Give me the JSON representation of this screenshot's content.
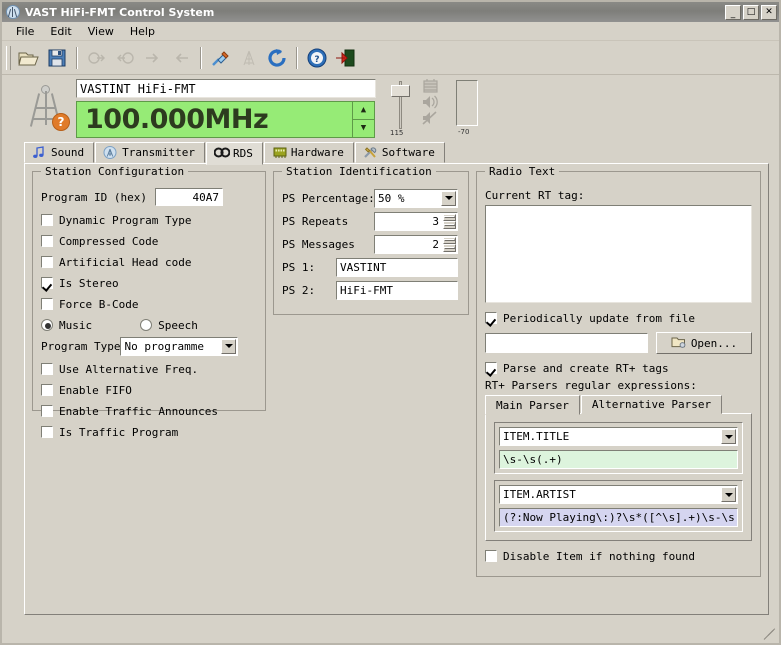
{
  "window": {
    "title": "VAST HiFi-FMT Control System",
    "icon": "antenna-icon",
    "minimize": "_",
    "maximize": "□",
    "close": "✕"
  },
  "menu": {
    "items": [
      "File",
      "Edit",
      "View",
      "Help"
    ]
  },
  "toolbar": {
    "buttons": [
      {
        "name": "open-file-icon",
        "enabled": true
      },
      {
        "name": "save-file-icon",
        "enabled": true
      },
      {
        "name": "upload-to-device-icon",
        "enabled": false
      },
      {
        "name": "download-from-device-icon",
        "enabled": false
      },
      {
        "name": "arrow-right-icon",
        "enabled": false
      },
      {
        "name": "arrow-left-icon",
        "enabled": false
      },
      {
        "name": "connect-icon",
        "enabled": true
      },
      {
        "name": "transmitter-icon",
        "enabled": false
      },
      {
        "name": "refresh-icon",
        "enabled": true
      },
      {
        "name": "help-icon",
        "enabled": true
      },
      {
        "name": "exit-icon",
        "enabled": true
      }
    ]
  },
  "header": {
    "station_name": "VASTINT HiFi-FMT",
    "frequency": "100.000MHz",
    "slider_value": "115",
    "meter_value": "-70",
    "status_badge": "?"
  },
  "tabs": [
    {
      "label": "Sound",
      "icon": "music-note-icon",
      "active": false
    },
    {
      "label": "Transmitter",
      "icon": "antenna-icon",
      "active": false
    },
    {
      "label": "RDS",
      "icon": "rds-icon",
      "active": true
    },
    {
      "label": "Hardware",
      "icon": "chip-icon",
      "active": false
    },
    {
      "label": "Software",
      "icon": "tools-icon",
      "active": false
    }
  ],
  "station_configuration": {
    "legend": "Station Configuration",
    "program_id_label": "Program ID (hex)",
    "program_id_value": "40A7",
    "checkboxes": [
      {
        "label": "Dynamic Program Type",
        "checked": false
      },
      {
        "label": "Compressed Code",
        "checked": false
      },
      {
        "label": "Artificial Head code",
        "checked": false
      },
      {
        "label": "Is Stereo",
        "checked": true
      },
      {
        "label": "Force B-Code",
        "checked": false
      }
    ],
    "radios": [
      {
        "label": "Music",
        "checked": true
      },
      {
        "label": "Speech",
        "checked": false
      }
    ],
    "program_type_label": "Program Type",
    "program_type_value": "No programme",
    "checkboxes2": [
      {
        "label": "Use Alternative Freq.",
        "checked": false
      },
      {
        "label": "Enable FIFO",
        "checked": false
      },
      {
        "label": "Enable Traffic Announces",
        "checked": false
      },
      {
        "label": "Is Traffic Program",
        "checked": false
      }
    ]
  },
  "station_identification": {
    "legend": "Station Identification",
    "fields": [
      {
        "label": "PS Percentage:",
        "value": "50 %",
        "type": "combo"
      },
      {
        "label": "PS Repeats",
        "value": "3",
        "type": "spinner"
      },
      {
        "label": "PS Messages",
        "value": "2",
        "type": "spinner"
      },
      {
        "label": "PS 1:",
        "value": "VASTINT",
        "type": "text"
      },
      {
        "label": "PS 2:",
        "value": "HiFi-FMT",
        "type": "text"
      }
    ]
  },
  "radio_text": {
    "legend": "Radio Text",
    "current_rt_label": "Current RT tag:",
    "current_rt_value": "",
    "periodic_update": {
      "label": "Periodically update from file",
      "checked": true
    },
    "file_path": "",
    "open_button": "Open...",
    "parse_rtplus": {
      "label": "Parse and create RT+ tags",
      "checked": true
    },
    "parsers_label": "RT+ Parsers regular expressions:",
    "parser_tabs": [
      {
        "label": "Main Parser",
        "active": true
      },
      {
        "label": "Alternative Parser",
        "active": false
      }
    ],
    "parsers": [
      {
        "item": "ITEM.TITLE",
        "regex": "\\s-\\s(.+)",
        "regex_bg": "#ddf4dd"
      },
      {
        "item": "ITEM.ARTIST",
        "regex": "(?:Now Playing\\:)?\\s*([^\\s].+)\\s-\\s",
        "regex_bg": "#d5d5f0"
      }
    ],
    "disable_item": {
      "label": "Disable Item if nothing found",
      "checked": false
    }
  },
  "colors": {
    "window_bg": "#d6d2c8",
    "freq_display_bg": "#96eb76",
    "freq_display_fg": "#2d3b1f",
    "titlebar_bg": "#7e7e7a",
    "accent_orange": "#e07b2a"
  }
}
